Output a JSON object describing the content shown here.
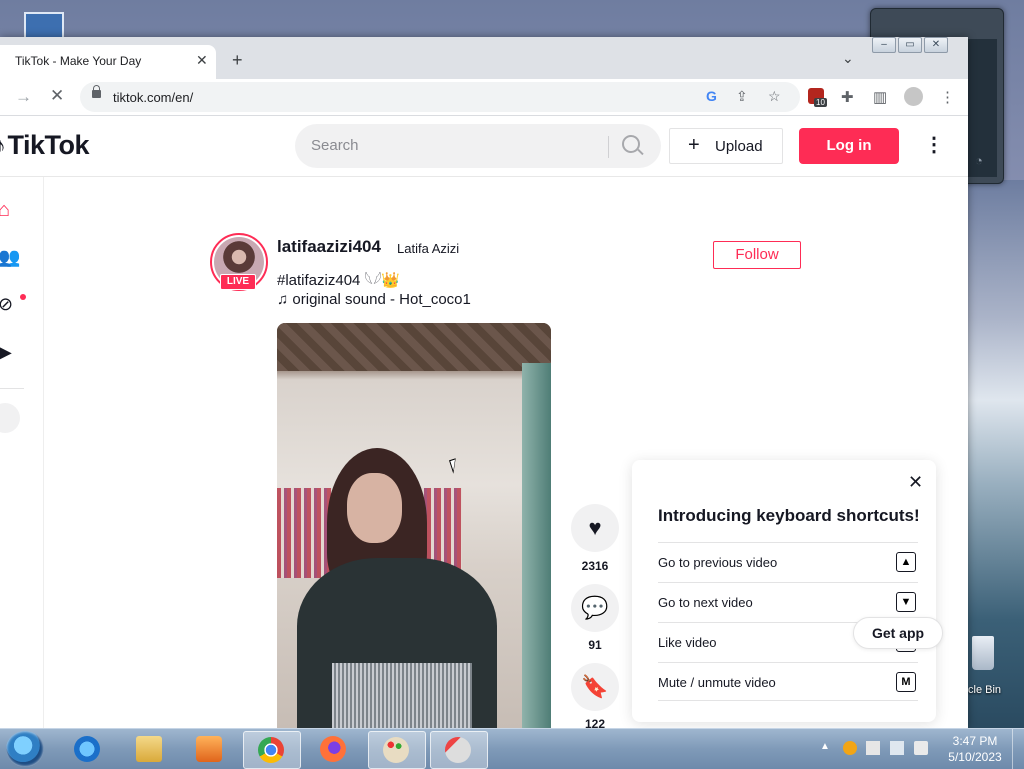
{
  "desktop": {
    "recycle_bin_label": "cle Bin"
  },
  "browser": {
    "tab_title": "TikTok - Make Your Day",
    "tab_close": "✕",
    "new_tab": "+",
    "url": "tiktok.com/en/",
    "extension_badge_count": "10"
  },
  "tiktok": {
    "logo": "TikTok",
    "search_placeholder": "Search",
    "upload_label": "Upload",
    "login_label": "Log in",
    "post": {
      "username": "latifaazizi404",
      "nickname": "Latifa Azizi",
      "live_badge": "LIVE",
      "caption": "#latifaziz404 𓆩𓆪👑",
      "music": "♫ original sound - Hot_coco1",
      "follow_label": "Follow",
      "likes": "2316",
      "comments": "91",
      "saves": "122"
    },
    "shortcuts": {
      "title": "Introducing keyboard shortcuts!",
      "items": [
        {
          "label": "Go to previous video",
          "key": "▲"
        },
        {
          "label": "Go to next video",
          "key": "▼"
        },
        {
          "label": "Like video",
          "key": "L"
        },
        {
          "label": "Mute / unmute video",
          "key": "M"
        }
      ]
    },
    "get_app_label": "Get app"
  },
  "taskbar": {
    "time": "3:47 PM",
    "date": "5/10/2023"
  },
  "colors": {
    "brand_pink": "#fe2c55",
    "text_dark": "#161823"
  }
}
